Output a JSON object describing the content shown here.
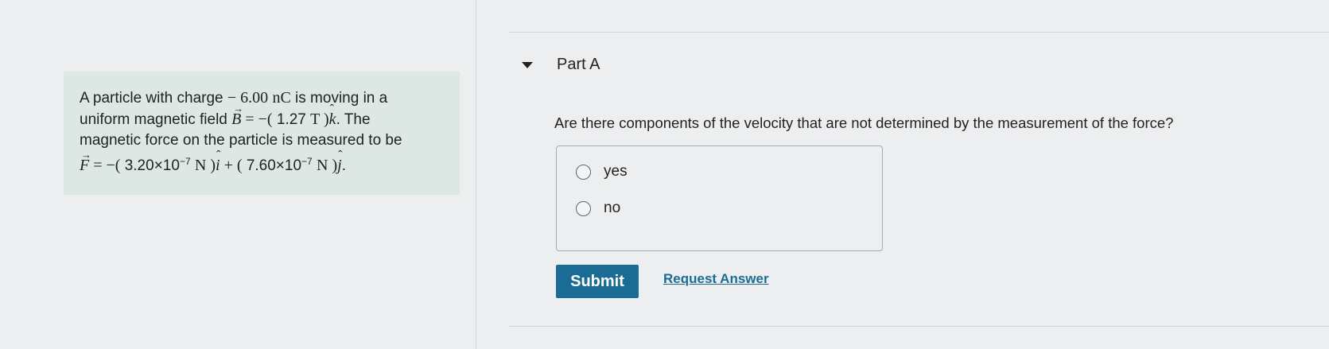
{
  "problem": {
    "line1_pre": "A particle with charge ",
    "charge_value": "− 6.00",
    "charge_unit": "nC",
    "line1_post": " is moving in a",
    "line2_pre": "uniform magnetic field ",
    "b_symbol": "B",
    "b_equals": " = −(",
    "b_value": " 1.27 ",
    "b_unit": "T",
    "b_close": " )",
    "k_hat": "k",
    "line2_post": ". The",
    "line3": "magnetic force on the particle is measured to be",
    "f_symbol": "F",
    "f_equals": " = −(",
    "fx_mantissa": " 3.20×10",
    "fx_exp": "−7",
    "unit_n": "N",
    "f_mid": " )",
    "i_hat": "i",
    "plus_open": " + (",
    "fy_mantissa": " 7.60×10",
    "fy_exp": "−7",
    "f_end": " )",
    "j_hat": "j",
    "period": "."
  },
  "part": {
    "title": "Part A",
    "question": "Are there components of the velocity that are not determined by the measurement of the force?",
    "options": [
      "yes",
      "no"
    ],
    "submit_label": "Submit",
    "request_label": "Request Answer"
  }
}
